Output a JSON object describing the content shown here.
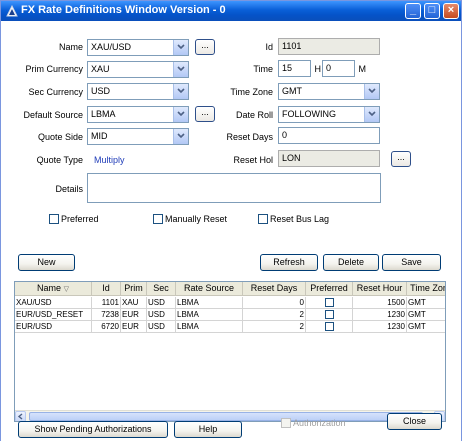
{
  "window": {
    "title": "FX Rate Definitions Window Version - 0",
    "minimize": "_",
    "maximize": "□",
    "close": "×"
  },
  "form": {
    "name_label": "Name",
    "name_value": "XAU/USD",
    "id_label": "Id",
    "id_value": "1101",
    "prim_currency_label": "Prim Currency",
    "prim_currency_value": "XAU",
    "time_label": "Time",
    "time_hour": "15",
    "hour_suffix": "H",
    "time_minute": "0",
    "minute_suffix": "M",
    "sec_currency_label": "Sec Currency",
    "sec_currency_value": "USD",
    "time_zone_label": "Time Zone",
    "time_zone_value": "GMT",
    "default_source_label": "Default Source",
    "default_source_value": "LBMA",
    "date_roll_label": "Date Roll",
    "date_roll_value": "FOLLOWING",
    "quote_side_label": "Quote Side",
    "quote_side_value": "MID",
    "reset_days_label": "Reset Days",
    "reset_days_value": "0",
    "quote_type_label": "Quote Type",
    "quote_type_value": "Multiply",
    "reset_hol_label": "Reset Hol",
    "reset_hol_value": "LON",
    "details_label": "Details",
    "details_value": "",
    "ellipsis": "...",
    "preferred_label": "Preferred",
    "manually_reset_label": "Manually Reset",
    "reset_bus_lag_label": "Reset Bus Lag"
  },
  "toolbar": {
    "new": "New",
    "refresh": "Refresh",
    "delete": "Delete",
    "save": "Save"
  },
  "table": {
    "columns": [
      "Name",
      "Id",
      "Prim",
      "Sec",
      "Rate Source",
      "Reset Days",
      "Preferred",
      "Reset Hour",
      "Time Zone"
    ],
    "sort_indicator": "▽",
    "rows": [
      {
        "name": "XAU/USD",
        "id": "1101",
        "prim": "XAU",
        "sec": "USD",
        "source": "LBMA",
        "reset_days": "0",
        "reset_hour": "1500",
        "tz": "GMT"
      },
      {
        "name": "EUR/USD_RESET",
        "id": "7238",
        "prim": "EUR",
        "sec": "USD",
        "source": "LBMA",
        "reset_days": "2",
        "reset_hour": "1230",
        "tz": "GMT"
      },
      {
        "name": "EUR/USD",
        "id": "6720",
        "prim": "EUR",
        "sec": "USD",
        "source": "LBMA",
        "reset_days": "2",
        "reset_hour": "1230",
        "tz": "GMT"
      }
    ]
  },
  "footer": {
    "pending": "Show Pending Authorizations",
    "help": "Help",
    "authorization": "Authorization",
    "close": "Close"
  }
}
